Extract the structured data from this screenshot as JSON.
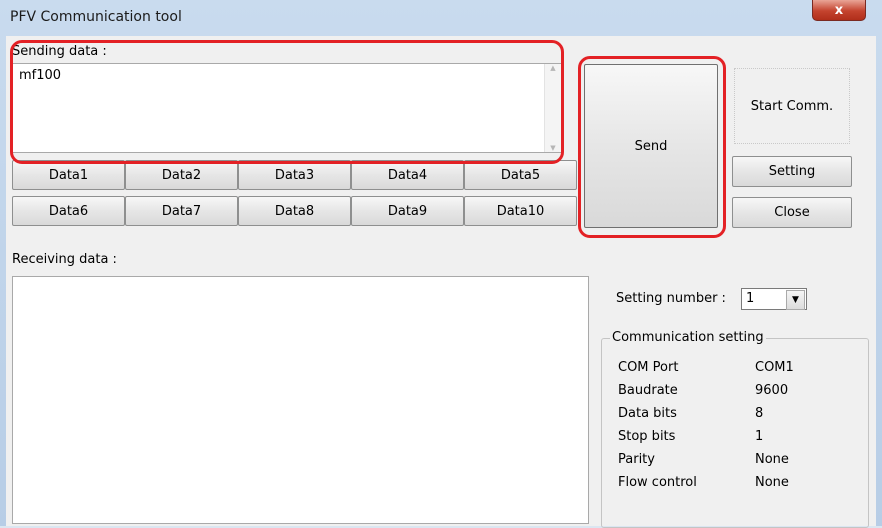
{
  "window": {
    "title": "PFV Communication tool",
    "close_glyph": "x"
  },
  "sending": {
    "label": "Sending data :",
    "value": "mf100",
    "data_buttons": [
      "Data1",
      "Data2",
      "Data3",
      "Data4",
      "Data5",
      "Data6",
      "Data7",
      "Data8",
      "Data9",
      "Data10"
    ]
  },
  "actions": {
    "send": "Send",
    "start": "Start Comm.",
    "setting": "Setting",
    "close": "Close"
  },
  "receiving": {
    "label": "Receiving data :",
    "value": ""
  },
  "setting_number": {
    "label": "Setting number :",
    "value": "1"
  },
  "comm": {
    "title": "Communication setting",
    "rows": [
      {
        "key": "COM Port",
        "value": "COM1"
      },
      {
        "key": "Baudrate",
        "value": "9600"
      },
      {
        "key": "Data bits",
        "value": "8"
      },
      {
        "key": "Stop bits",
        "value": "1"
      },
      {
        "key": "Parity",
        "value": "None"
      },
      {
        "key": "Flow control",
        "value": "None"
      }
    ]
  },
  "colors": {
    "highlight": "#e32125",
    "window_frame": "#c9dbee"
  },
  "icons": {
    "close": "close-icon",
    "dropdown": "chevron-down-icon"
  }
}
